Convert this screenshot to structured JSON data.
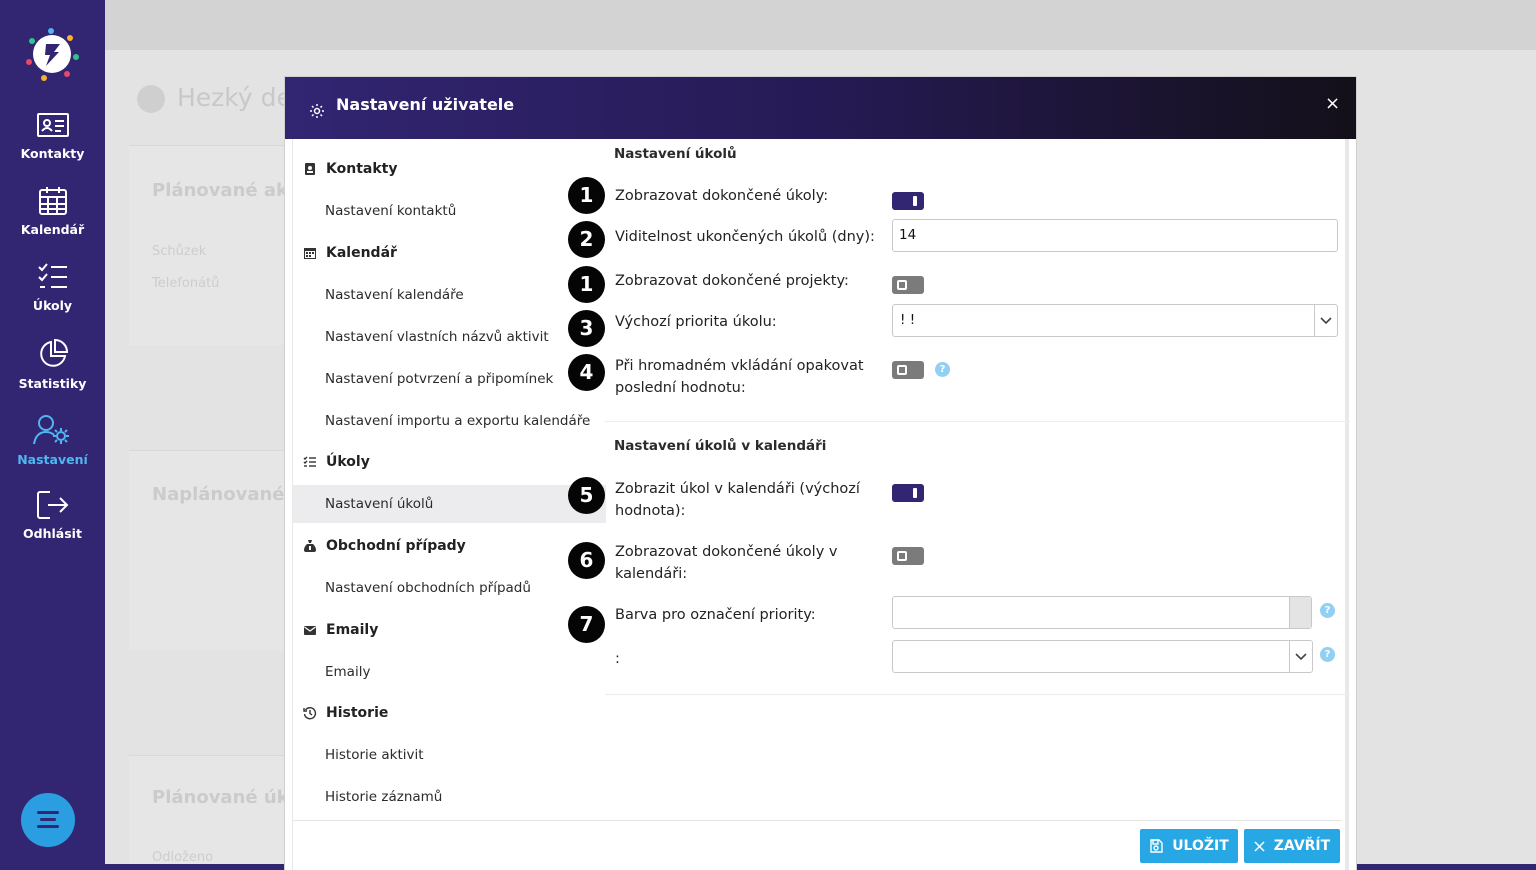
{
  "sidebar": {
    "items": [
      {
        "label": "Kontakty",
        "icon": "contact-card-icon"
      },
      {
        "label": "Kalendář",
        "icon": "calendar-icon"
      },
      {
        "label": "Úkoly",
        "icon": "checklist-icon"
      },
      {
        "label": "Statistiky",
        "icon": "pie-chart-icon"
      },
      {
        "label": "Nastavení",
        "icon": "users-gear-icon",
        "active": true
      },
      {
        "label": "Odhlásit",
        "icon": "logout-icon"
      }
    ],
    "colors": {
      "background": "#322572",
      "active": "#4fb6ef",
      "chat": "#2a9ee0"
    }
  },
  "background_page": {
    "title": "Hezký de",
    "sections": [
      "Plánované ak",
      "Naplánované",
      "Plánované úk"
    ],
    "rows": [
      "Schůzek",
      "Telefonátů",
      "Odloženo"
    ]
  },
  "modal": {
    "title": "Nastavení uživatele",
    "close_label": "×",
    "menu": [
      {
        "group": "Kontakty",
        "icon": "contact-book-icon",
        "items": [
          "Nastavení kontaktů"
        ]
      },
      {
        "group": "Kalendář",
        "icon": "calendar-icon",
        "items": [
          "Nastavení kalendáře",
          "Nastavení vlastních názvů aktivit",
          "Nastavení potvrzení a připomínek",
          "Nastavení importu a exportu kalendáře"
        ]
      },
      {
        "group": "Úkoly",
        "icon": "task-list-icon",
        "items": [
          "Nastavení úkolů"
        ]
      },
      {
        "group": "Obchodní případy",
        "icon": "money-bag-icon",
        "items": [
          "Nastavení obchodních případů"
        ]
      },
      {
        "group": "Emaily",
        "icon": "envelope-icon",
        "items": [
          "Emaily"
        ]
      },
      {
        "group": "Historie",
        "icon": "history-icon",
        "items": [
          "Historie aktivit",
          "Historie záznamů"
        ]
      }
    ],
    "active_menu_item": "Nastavení úkolů",
    "sections": [
      {
        "title": "Nastavení úkolů"
      },
      {
        "title": "Nastavení úkolů v kalendáři"
      }
    ],
    "fields": {
      "show_completed_tasks": {
        "num": "1",
        "label": "Zobrazovat dokončené úkoly:",
        "on": true
      },
      "visibility_days": {
        "num": "2",
        "label": "Viditelnost ukončených úkolů (dny):",
        "value": "14"
      },
      "show_completed_projects": {
        "num": "1",
        "label": "Zobrazovat dokončené projekty:",
        "on": false
      },
      "default_priority": {
        "num": "3",
        "label": "Výchozí priorita úkolu:",
        "value": "! !"
      },
      "repeat_last_value": {
        "num": "4",
        "label": "Při hromadném vkládání opakovat poslední hodnotu:",
        "on": false,
        "help": "?"
      },
      "show_in_calendar": {
        "num": "5",
        "label": "Zobrazit úkol v kalendáři (výchozí hodnota):",
        "on": true
      },
      "show_completed_in_calendar": {
        "num": "6",
        "label": "Zobrazovat dokončené úkoly v kalendáři:",
        "on": false
      },
      "priority_color": {
        "num": "7",
        "label": "Barva pro označení priority:",
        "value": "",
        "help": "?"
      },
      "extra": {
        "label": ":",
        "value": "",
        "help": "?"
      }
    },
    "buttons": {
      "save": "ULOŽIT",
      "close": "ZAVŘÍT"
    },
    "colors": {
      "header_start": "#322572",
      "header_end": "#141019",
      "toggle_on": "#322572",
      "toggle_off": "#7b7b7b",
      "button": "#27a7e3",
      "help": "#8fd0f3"
    }
  }
}
